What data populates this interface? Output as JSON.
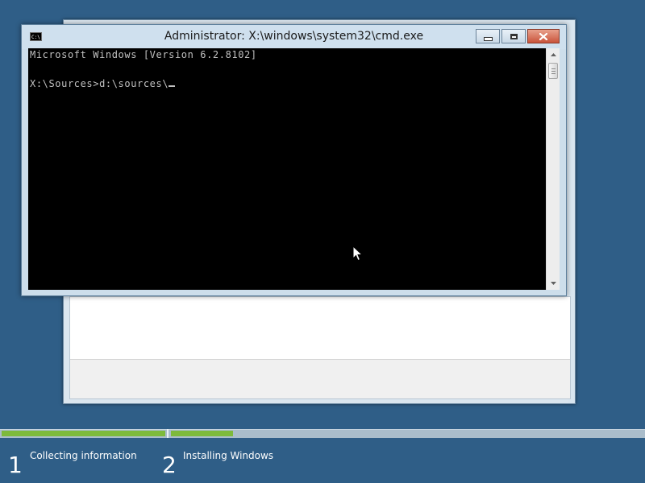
{
  "cmd_window": {
    "title": "Administrator: X:\\windows\\system32\\cmd.exe",
    "icon_text": "C:\\",
    "console_lines": [
      "Microsoft Windows [Version 6.2.8102]",
      "",
      "X:\\Sources>d:\\sources\\"
    ]
  },
  "setup": {
    "steps": [
      {
        "number": "1",
        "label": "Collecting information"
      },
      {
        "number": "2",
        "label": "Installing Windows"
      }
    ],
    "progress": {
      "step1_fraction": 1.0,
      "step2_fraction": 0.35
    }
  },
  "colors": {
    "desktop_background": "#2f5e87",
    "progress_green": "#7dba3c",
    "console_background": "#000000",
    "console_text": "#c0c0c0"
  },
  "icons": {
    "minimize": "minimize-icon",
    "maximize": "maximize-icon",
    "close": "close-icon",
    "scroll_up": "scroll-up-icon",
    "scroll_down": "scroll-down-icon",
    "pointer": "mouse-pointer-icon"
  }
}
